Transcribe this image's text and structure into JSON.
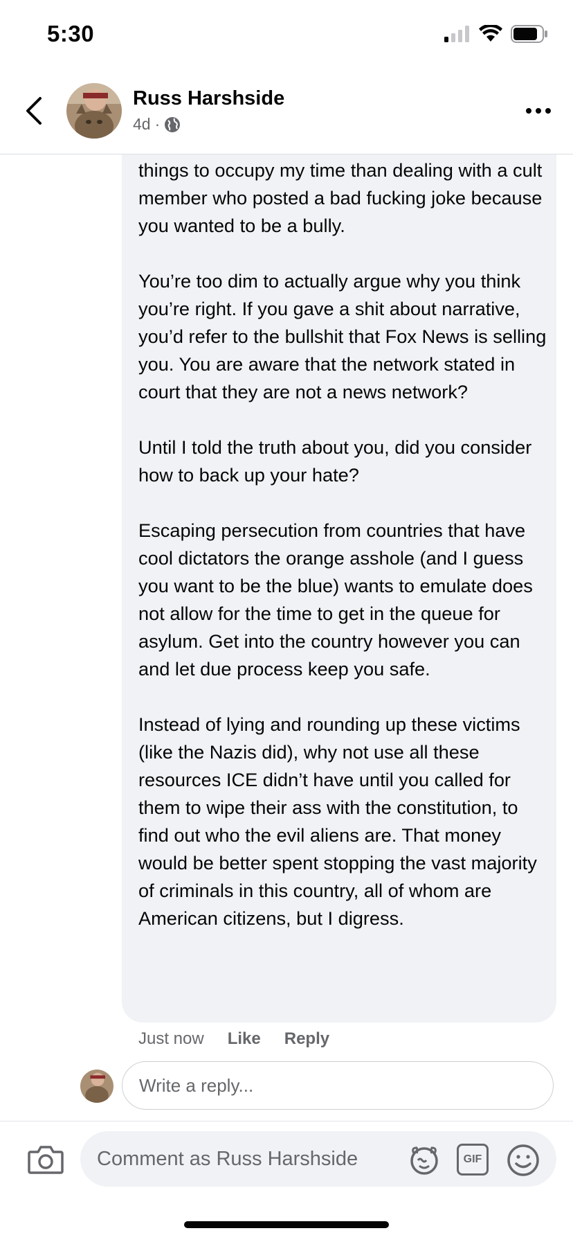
{
  "status_bar": {
    "time": "5:30"
  },
  "header": {
    "name": "Russ Harshside",
    "age": "4d",
    "separator": "·"
  },
  "comment": {
    "paragraphs": [
      "things to occupy my time than dealing with a cult member who posted a bad fucking joke because you wanted to be a bully.",
      "You’re too dim to actually argue why you think you’re right. If you gave a shit about narrative, you’d refer to the bullshit that Fox News is selling you. You are aware that the network stated in court that they are not a news network?",
      "Until I told the truth about you, did you consider how to back up your hate?",
      "Escaping persecution from countries that have cool dictators the orange asshole (and I guess you want to be the blue) wants to emulate does not allow for the time to get in the queue for asylum. Get into the country however you can and let due process keep you safe.",
      "Instead of lying and rounding up these victims (like the Nazis did), why not use all these resources ICE didn’t have until you called for them to wipe their ass with the constitution, to find out who the evil aliens are. That money would be better spent stopping the vast majority of criminals in this country, all of whom are American citizens, but I digress."
    ],
    "time": "Just now",
    "like_label": "Like",
    "reply_label": "Reply"
  },
  "reply_box": {
    "placeholder": "Write a reply..."
  },
  "composer": {
    "placeholder": "Comment as Russ Harshside",
    "gif_label": "GIF"
  },
  "icons": {
    "back": "chevron-left-icon",
    "more": "more-horizontal-icon",
    "globe": "globe-icon",
    "camera": "camera-icon",
    "sticker": "sticker-icon",
    "gif": "gif-icon",
    "emoji": "emoji-icon"
  },
  "colors": {
    "bubble_bg": "#f0f2f5",
    "secondary_text": "#65676b",
    "primary_text": "#050505"
  }
}
